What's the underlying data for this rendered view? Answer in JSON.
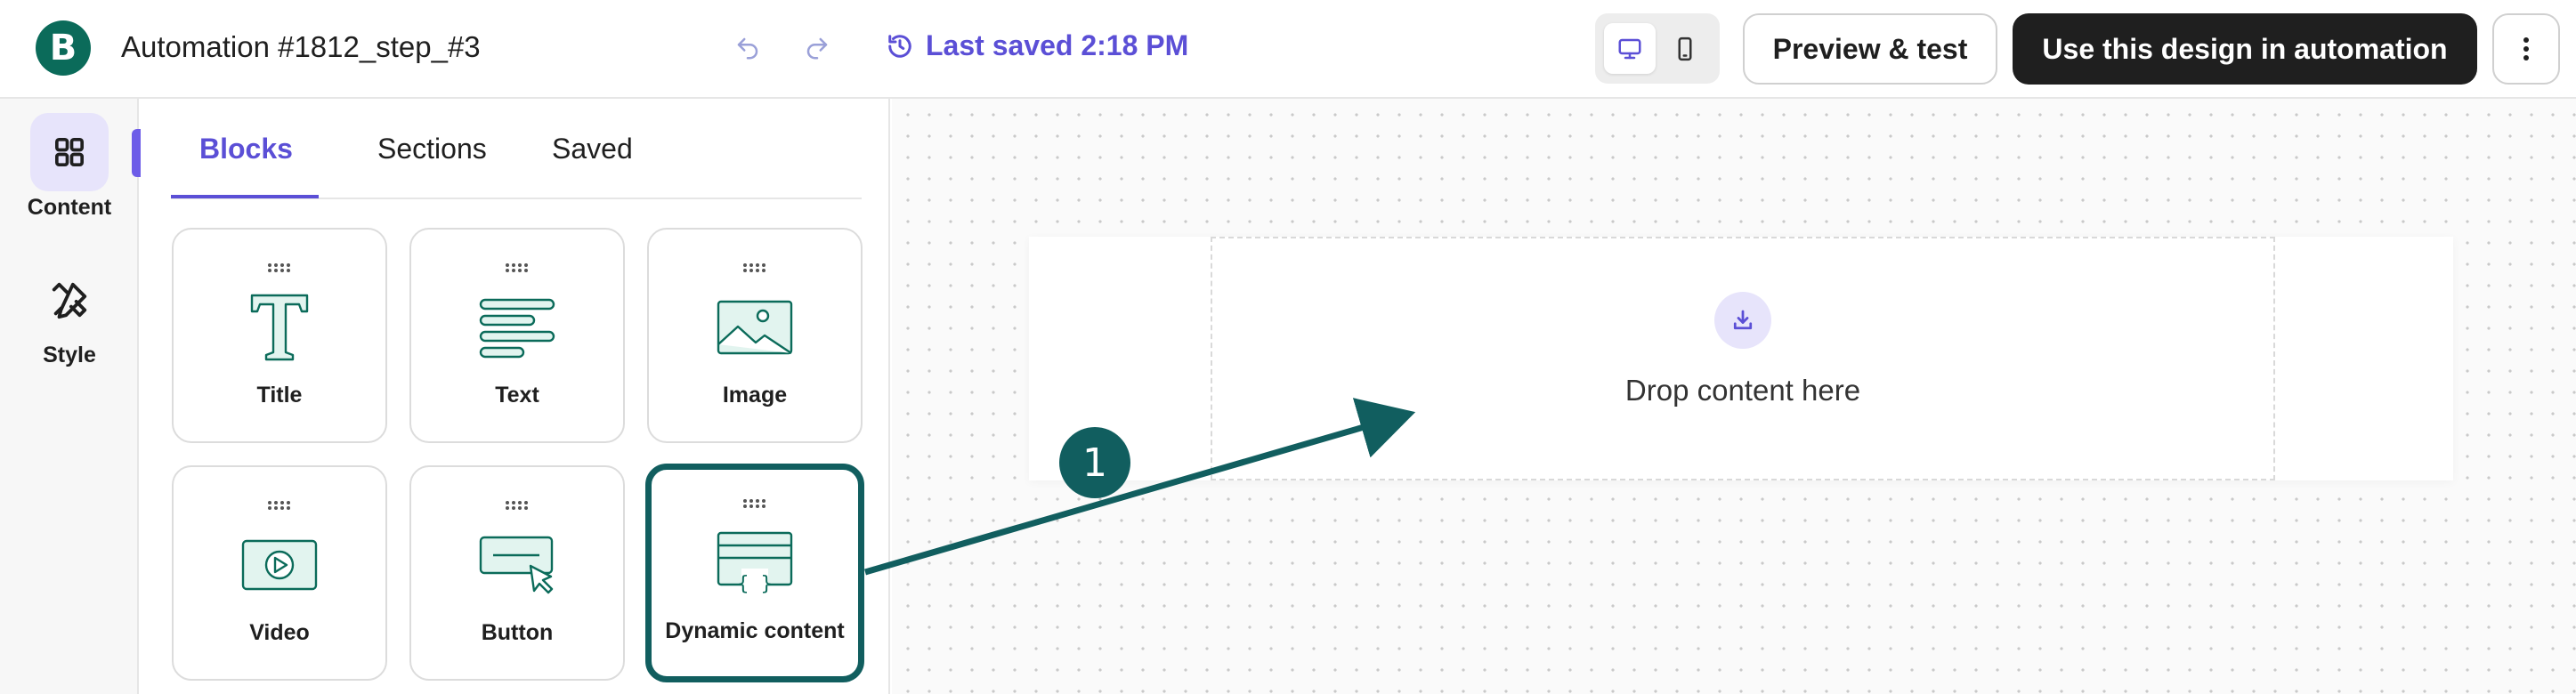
{
  "header": {
    "logo_letter": "B",
    "title": "Automation #1812_step_#3",
    "saved_text": "Last saved 2:18 PM",
    "preview_label": "Preview & test",
    "use_design_label": "Use this design in automation"
  },
  "rail": {
    "items": [
      {
        "label": "Content",
        "active": true
      },
      {
        "label": "Style",
        "active": false
      }
    ]
  },
  "panel": {
    "tabs": [
      {
        "label": "Blocks",
        "active": true
      },
      {
        "label": "Sections",
        "active": false
      },
      {
        "label": "Saved",
        "active": false
      }
    ],
    "blocks": [
      {
        "label": "Title",
        "icon": "title-icon"
      },
      {
        "label": "Text",
        "icon": "text-icon"
      },
      {
        "label": "Image",
        "icon": "image-icon"
      },
      {
        "label": "Video",
        "icon": "video-icon"
      },
      {
        "label": "Button",
        "icon": "button-icon"
      },
      {
        "label": "Dynamic content",
        "icon": "dynamic-content-icon",
        "highlighted": true
      }
    ]
  },
  "canvas": {
    "drop_text": "Drop content here"
  },
  "annotation": {
    "step_number": "1"
  },
  "colors": {
    "brand": "#0b6b5a",
    "accent": "#5b4fd6",
    "annotation": "#115e5f",
    "primary_button": "#1f1f1f"
  }
}
